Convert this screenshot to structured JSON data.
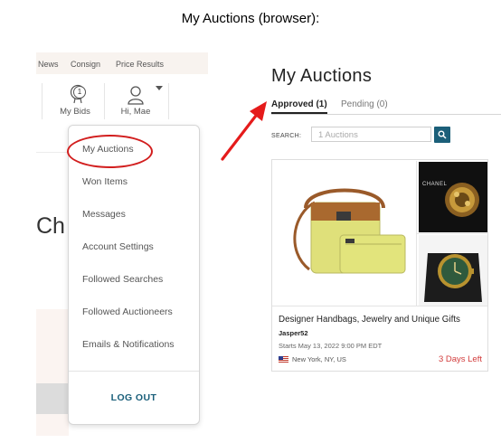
{
  "caption": "My Auctions (browser):",
  "site_nav": {
    "news": "News",
    "consign": "Consign",
    "price_results": "Price Results"
  },
  "header_icons": {
    "bids_badge": "1",
    "my_bids": "My Bids",
    "greeting": "Hi, Mae"
  },
  "background_text": {
    "heading_fragment": "Ch"
  },
  "account_menu": {
    "items": [
      "My Auctions",
      "Won Items",
      "Messages",
      "Account Settings",
      "Followed Searches",
      "Followed Auctioneers",
      "Emails & Notifications"
    ],
    "logout": "LOG OUT"
  },
  "my_auctions": {
    "title": "My Auctions",
    "tabs": [
      {
        "label": "Approved (1)",
        "active": true
      },
      {
        "label": "Pending (0)",
        "active": false
      }
    ],
    "search": {
      "label": "SEARCH:",
      "placeholder": "1 Auctions"
    },
    "card": {
      "title": "Designer Handbags, Jewelry and Unique Gifts",
      "seller": "Jasper52",
      "start": "Starts May 13, 2022 9:00 PM EDT",
      "location": "New York, NY, US",
      "time_left": "3 Days Left",
      "image_brand_text": "CHANEL"
    }
  },
  "colors": {
    "annotation_red": "#d21e1e",
    "accent_teal": "#1b5f79",
    "time_left_red": "#d23b3b"
  },
  "icons": {
    "bids": "paddle-icon",
    "account": "user-icon",
    "dropdown": "caret-down-icon",
    "search": "search-icon",
    "flag": "us-flag-icon"
  }
}
